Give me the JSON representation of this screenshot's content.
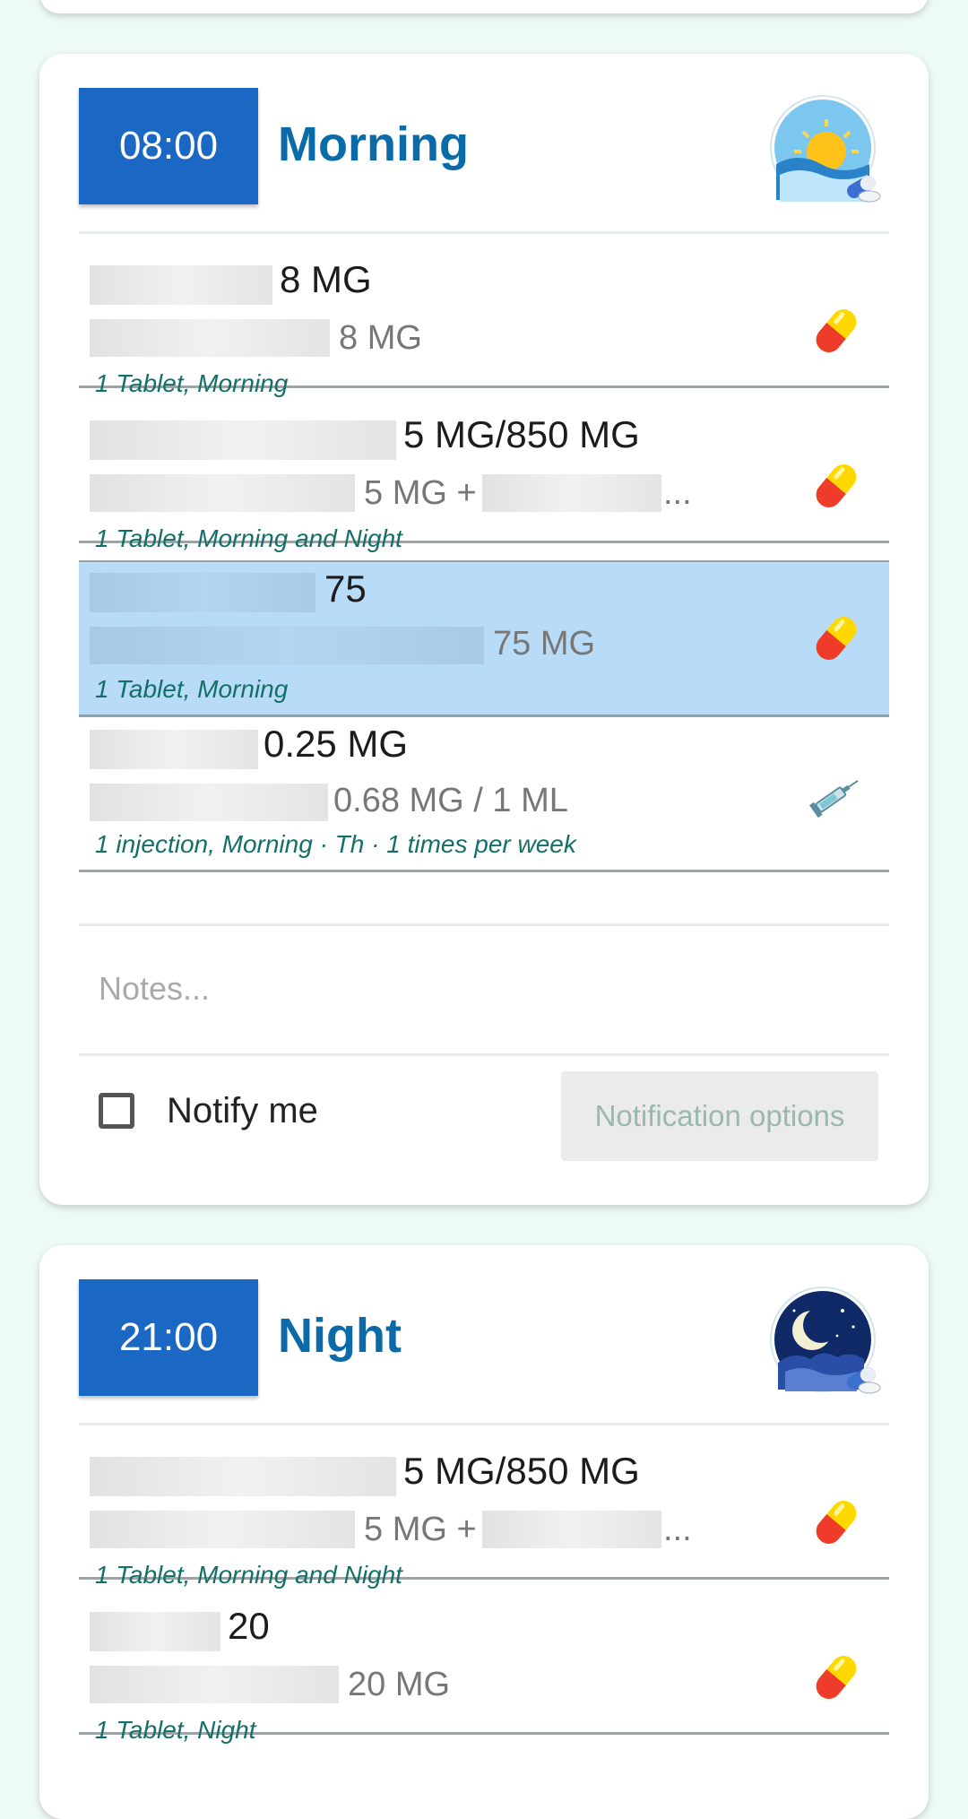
{
  "morning": {
    "time": "08:00",
    "title": "Morning",
    "icon": "sun-pills-icon",
    "medications": [
      {
        "name_suffix": "8 MG",
        "strength_suffix": "8 MG",
        "dose": "1 Tablet, Morning",
        "icon": "capsule-icon"
      },
      {
        "name_suffix": "5 MG/850 MG",
        "strength_suffix": "5 MG +",
        "strength_ellipsis": "...",
        "dose": "1 Tablet, Morning and Night",
        "icon": "capsule-icon"
      },
      {
        "name_suffix": "75",
        "strength_suffix": "75 MG",
        "dose": "1 Tablet, Morning",
        "icon": "capsule-icon",
        "selected": true
      },
      {
        "name_suffix": "0.25 MG",
        "strength_suffix": "0.68 MG / 1 ML",
        "dose": "1 injection, Morning · Th · 1 times per week",
        "icon": "syringe-icon"
      }
    ],
    "notes_placeholder": "Notes...",
    "notify_label": "Notify me",
    "notify_checked": false,
    "notification_options": "Notification options"
  },
  "night": {
    "time": "21:00",
    "title": "Night",
    "icon": "moon-pills-icon",
    "medications": [
      {
        "name_suffix": "5 MG/850 MG",
        "strength_suffix": "5 MG +",
        "strength_ellipsis": "...",
        "dose": "1 Tablet, Morning and Night",
        "icon": "capsule-icon"
      },
      {
        "name_suffix": "20",
        "strength_suffix": "20 MG",
        "dose": "1 Tablet, Night",
        "icon": "capsule-icon"
      }
    ]
  },
  "colors": {
    "time_box": "#1a67c4",
    "title": "#0b6aa8",
    "selected_row": "#b8dbf8",
    "dose_text": "#137068",
    "background": "#eefaf6"
  }
}
